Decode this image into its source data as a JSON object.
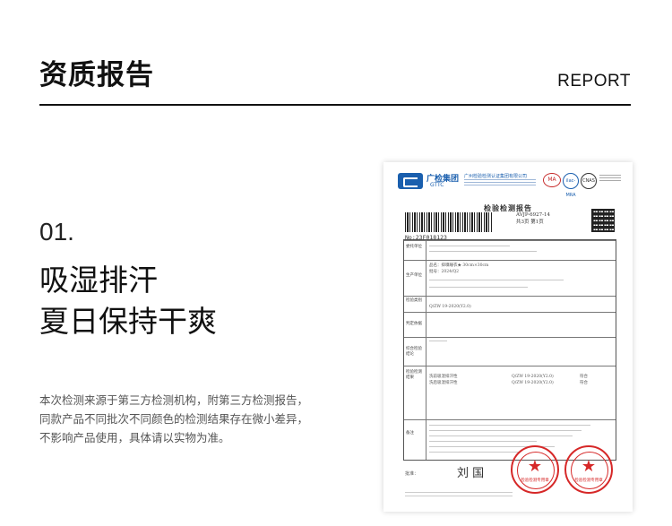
{
  "header": {
    "title": "资质报告",
    "report_label": "REPORT"
  },
  "section": {
    "number": "01.",
    "headline_line1": "吸湿排汗",
    "headline_line2": "夏日保持干爽",
    "description_line1": "本次检测来源于第三方检测机构，附第三方检测报告，",
    "description_line2": "同款产品不同批次不同颜色的检测结果存在微小差异，",
    "description_line3": "不影响产品使用，具体请以实物为准。"
  },
  "certificate": {
    "org_name": "广检集团",
    "org_sub": "GTTC",
    "org_full": "广州检验检测认证集团有限公司",
    "report_title": "检验检测报告",
    "report_code": "AVJP-6927-14",
    "report_no": "No:23F018123",
    "page_info": "共3页 第1页",
    "mark_ma": "MA",
    "mark_ilac": "ilac-MRA",
    "mark_cnas": "CNAS",
    "rows": [
      "委托单位",
      "生产单位",
      "检验类别",
      "判定依据",
      "综合检验结论",
      "检验检测结果",
      "备注"
    ],
    "product_line": "品名：抑嗅睡衣★ 30cm×30cm",
    "batch_line": "批号：2024/Q2",
    "standard_line": "Q/ZW 19-2020(Y2.0)",
    "item_1": "洗前吸湿排汗性",
    "item_2": "洗后吸湿排汗性",
    "result": "符合",
    "signer_label": "批准：",
    "signature": "刘 国",
    "seal_text": "检验检测专用章"
  }
}
